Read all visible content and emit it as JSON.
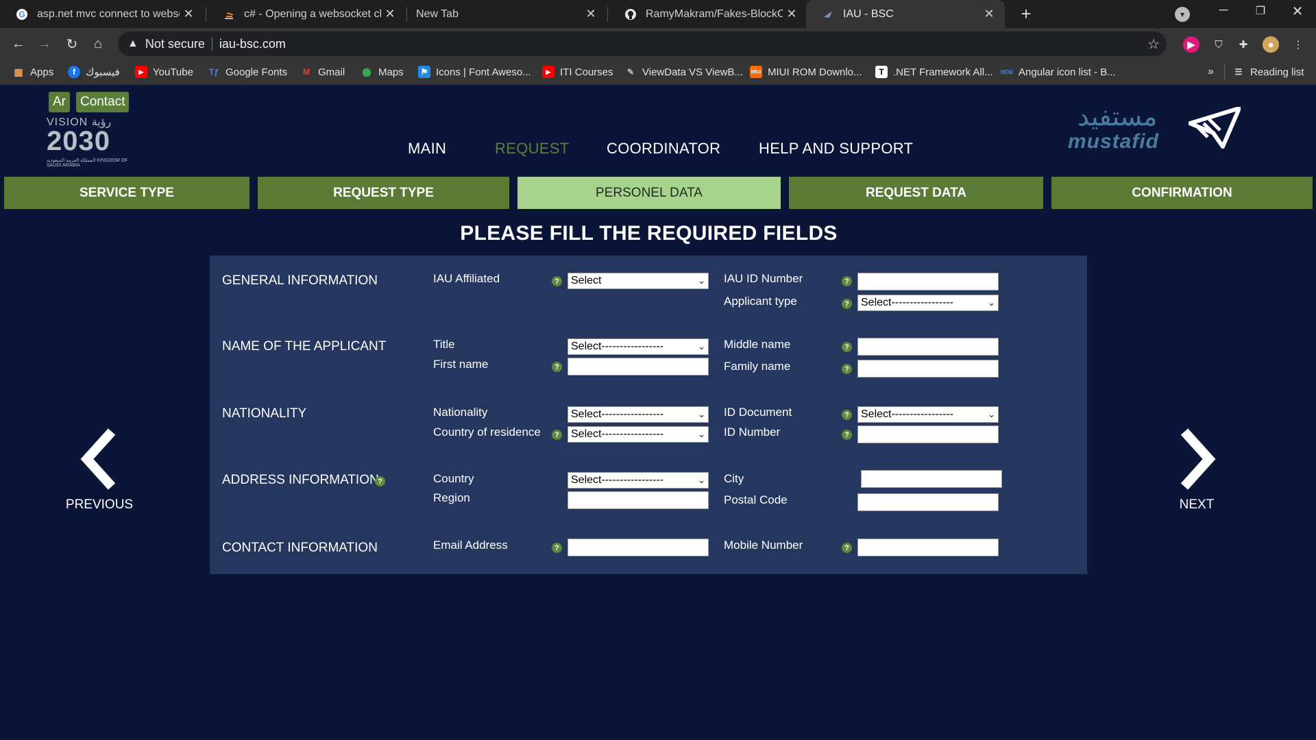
{
  "browser": {
    "tabs": [
      {
        "title": "asp.net mvc connect to websocke",
        "favicon": "google-icon",
        "active": false
      },
      {
        "title": "c# - Opening a websocket chann",
        "favicon": "stackoverflow-icon",
        "active": false
      },
      {
        "title": "New Tab",
        "favicon": "",
        "active": false
      },
      {
        "title": "RamyMakram/Fakes-BlockChain",
        "favicon": "github-icon",
        "active": false
      },
      {
        "title": "IAU - BSC",
        "favicon": "site-icon",
        "active": true
      }
    ],
    "new_tab_symbol": "+",
    "omnibox": {
      "security": "Not secure",
      "url": "iau-bsc.com"
    },
    "bookmarks": [
      {
        "label": "Apps",
        "icon": "apps-grid-icon"
      },
      {
        "label": "فيسبوك",
        "icon": "facebook-icon"
      },
      {
        "label": "YouTube",
        "icon": "youtube-icon"
      },
      {
        "label": "Google Fonts",
        "icon": "google-fonts-icon"
      },
      {
        "label": "Gmail",
        "icon": "gmail-icon"
      },
      {
        "label": "Maps",
        "icon": "maps-icon"
      },
      {
        "label": "Icons | Font Aweso...",
        "icon": "flag-icon"
      },
      {
        "label": "ITI Courses",
        "icon": "youtube-icon"
      },
      {
        "label": "ViewData VS ViewB...",
        "icon": "bookmark-icon"
      },
      {
        "label": "MIUI ROM Downlo...",
        "icon": "miui-icon"
      },
      {
        "label": ".NET Framework All...",
        "icon": "tt-icon"
      },
      {
        "label": "Angular icon list - B...",
        "icon": "mdb-icon"
      }
    ],
    "bookmarks_overflow": "»",
    "reading_list": "Reading list",
    "colors": {
      "tab_strip": "#1f1f1f",
      "toolbar": "#353535"
    }
  },
  "page": {
    "lang_button": "Ar",
    "contact_button": "Contact",
    "vision_logo": {
      "line1": "VISION رؤية",
      "line2": "2030",
      "line3": "المملكة العربية السعودية KINGDOM OF SAUDI ARABIA"
    },
    "nav": [
      "MAIN",
      "REQUEST",
      "COORDINATOR",
      "HELP AND SUPPORT"
    ],
    "nav_active": "REQUEST",
    "brand": {
      "arabic": "مستفيد",
      "latin": "mustafid"
    },
    "steps": [
      "SERVICE TYPE",
      "REQUEST TYPE",
      "PERSONEL DATA",
      "REQUEST DATA",
      "CONFIRMATION"
    ],
    "active_step": "PERSONEL DATA",
    "heading": "PLEASE FILL THE REQUIRED FIELDS",
    "help_symbol": "?",
    "form": {
      "general": {
        "title": "GENERAL INFORMATION",
        "iau_affiliated_label": "IAU Affiliated",
        "iau_affiliated_value": "Select",
        "iau_id_label": "IAU ID Number",
        "applicant_type_label": "Applicant type",
        "applicant_type_value": "Select-----------------"
      },
      "name": {
        "title": "NAME OF THE APPLICANT",
        "title_label": "Title",
        "title_value": "Select-----------------",
        "first_name_label": "First name",
        "middle_name_label": "Middle name",
        "family_name_label": "Family name"
      },
      "nationality": {
        "title": "NATIONALITY",
        "nationality_label": "Nationality",
        "nationality_value": "Select-----------------",
        "residence_label": "Country of residence",
        "residence_value": "Select-----------------",
        "id_document_label": "ID Document",
        "id_document_value": "Select-----------------",
        "id_number_label": "ID Number"
      },
      "address": {
        "title": "ADDRESS INFORMATION",
        "country_label": "Country",
        "country_value": "Select-----------------",
        "region_label": "Region",
        "city_label": "City",
        "postal_label": "Postal Code"
      },
      "contact": {
        "title": "CONTACT INFORMATION",
        "email_label": "Email Address",
        "mobile_label": "Mobile Number"
      }
    },
    "previous": "PREVIOUS",
    "next": "NEXT",
    "colors": {
      "background": "#0b1538",
      "panel": "#26375f",
      "step": "#5a7a36",
      "step_active": "#a8d38c",
      "nav_active": "#5e7f3c"
    }
  }
}
